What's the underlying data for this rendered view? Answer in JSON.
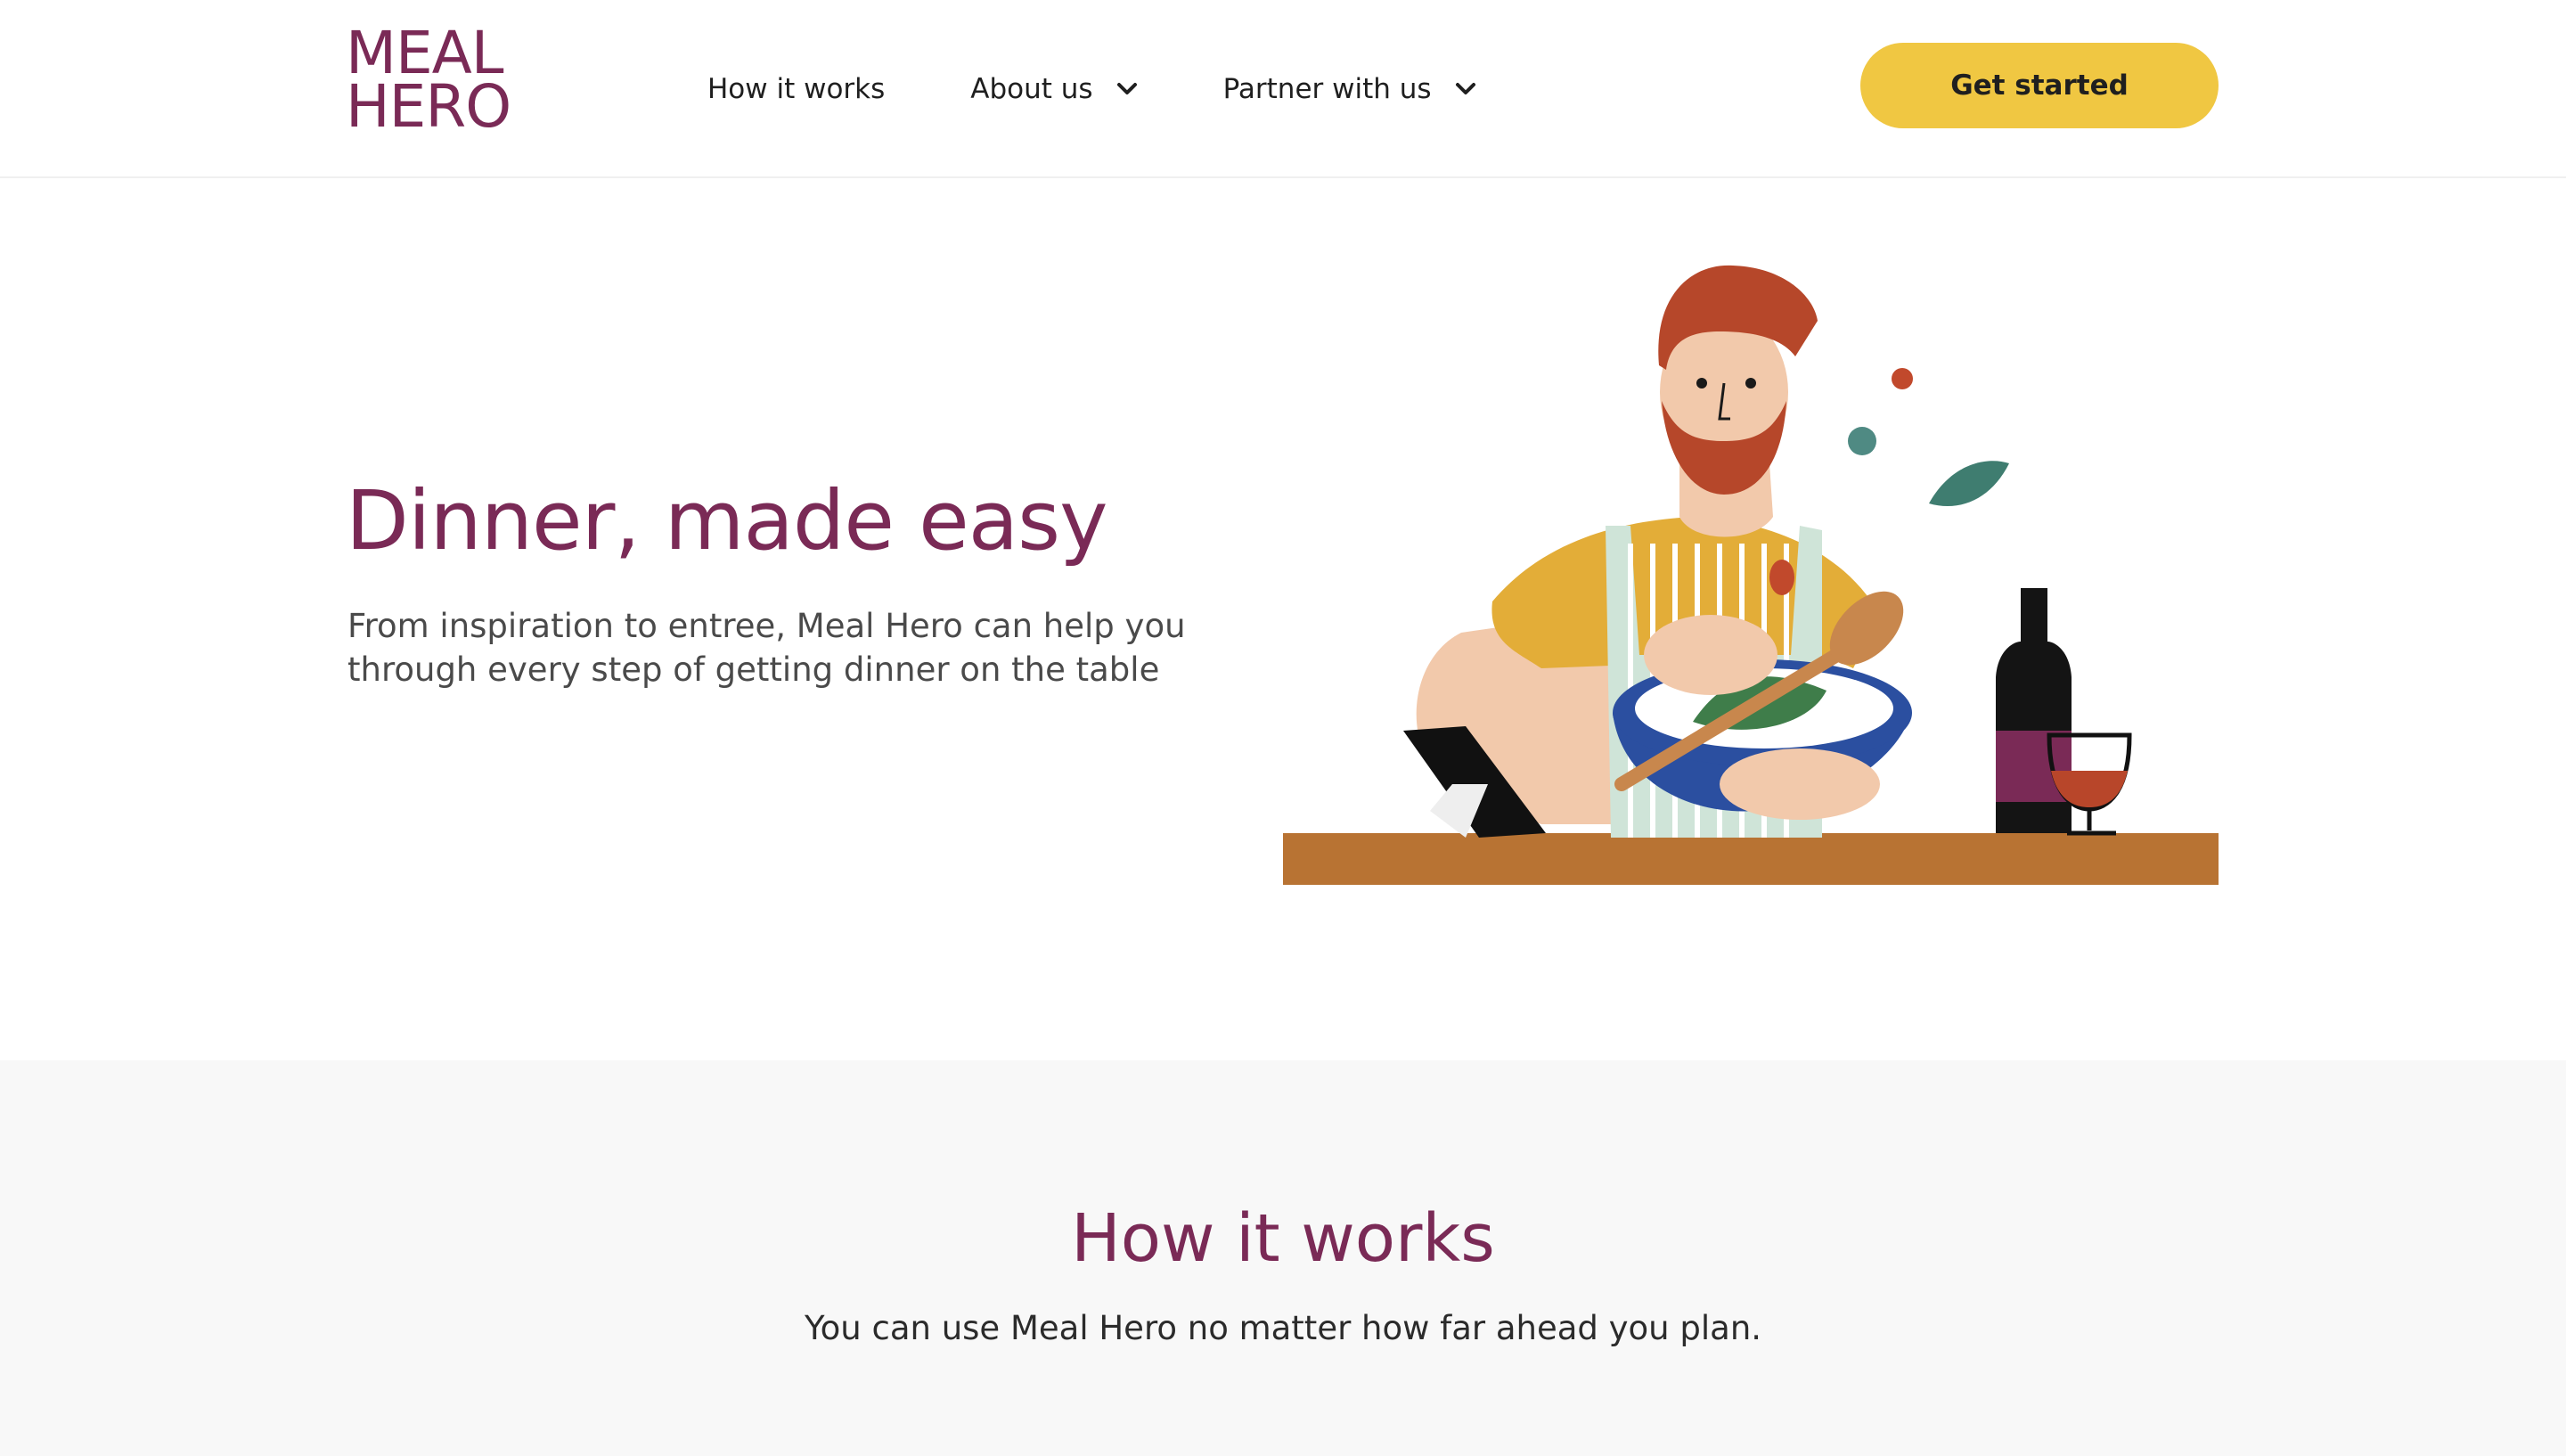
{
  "header": {
    "logo": {
      "line1": "MEAL",
      "line2": "HERO"
    },
    "nav": [
      {
        "label": "How it works",
        "has_dropdown": false
      },
      {
        "label": "About us",
        "has_dropdown": true
      },
      {
        "label": "Partner with us",
        "has_dropdown": true
      }
    ],
    "cta_label": "Get started"
  },
  "hero": {
    "title": "Dinner, made easy",
    "subtitle": "From inspiration to entree, Meal Hero can help you through every step of getting dinner on the table"
  },
  "how_it_works": {
    "title": "How it works",
    "subtitle": "You can use Meal Hero no matter how far ahead you plan."
  },
  "colors": {
    "brand": "#7a2a56",
    "cta": "#f0c742",
    "section_bg": "#f8f8f8"
  }
}
